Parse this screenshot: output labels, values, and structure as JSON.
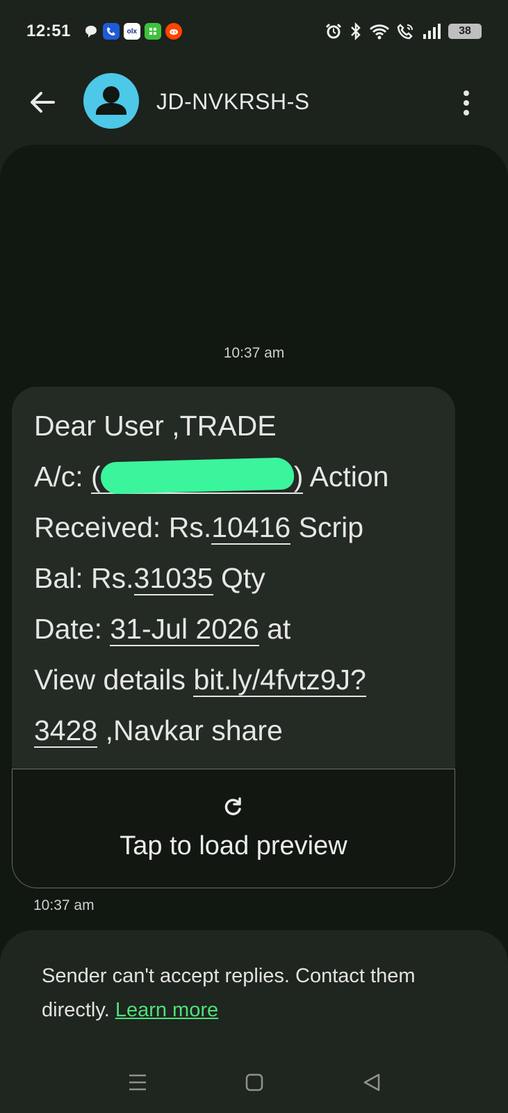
{
  "status_bar": {
    "time": "12:51",
    "battery": "38",
    "icons": [
      "chat-bubble-icon",
      "phone-app-icon",
      "olx-icon",
      "green-app-icon",
      "reddit-icon",
      "alarm-icon",
      "bluetooth-icon",
      "wifi-icon",
      "wifi-calling-icon",
      "signal-icon",
      "battery-icon"
    ],
    "olx_label": "olx"
  },
  "header": {
    "contact_name": "JD-NVKRSH-S",
    "avatar_color": "#4dc8e8"
  },
  "conversation": {
    "timestamp_top": "10:37 am",
    "message": {
      "l1": "Dear User ,TRADE",
      "l2_a": "A/c: ",
      "l2_b": "(",
      "l2_c": ")",
      "l2_d": " Action",
      "l3_a": "Received: Rs.",
      "l3_b": "10416",
      "l3_c": " Scrip",
      "l4_a": "Bal: Rs.",
      "l4_b": "31035",
      "l4_c": " Qty",
      "l5_a": "Date: ",
      "l5_b": "31-Jul 2026",
      "l5_c": " at",
      "l6_a": "View details ",
      "l6_b": "bit.ly/4fvtz9J?",
      "l7_a": "3428",
      "l7_b": " ,Navkar share"
    },
    "preview_label": "Tap to load preview",
    "timestamp_bottom": "10:37 am"
  },
  "notice": {
    "text": "Sender can't accept replies. Contact them directly. ",
    "link": "Learn more",
    "link_color": "#4ee07b"
  },
  "colors": {
    "background": "#1c221c",
    "conversation_bg": "#111711",
    "bubble_bg": "#242a24",
    "redaction": "#3af59b"
  }
}
